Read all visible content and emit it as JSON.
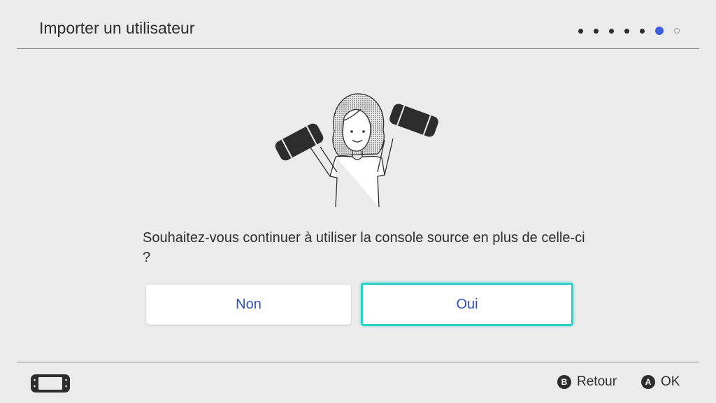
{
  "header": {
    "title": "Importer un utilisateur",
    "progress": {
      "total_steps": 7,
      "current_step": 6
    }
  },
  "illustration": {
    "name": "woman-holding-consoles"
  },
  "dialog": {
    "question": "Souhaitez-vous continuer à utiliser la console source en plus de celle-ci ?",
    "options": [
      {
        "label": "Non",
        "selected": false
      },
      {
        "label": "Oui",
        "selected": true
      }
    ]
  },
  "footer": {
    "console_icon": "handheld-console-icon",
    "back": {
      "button": "B",
      "label": "Retour"
    },
    "ok": {
      "button": "A",
      "label": "OK"
    }
  },
  "colors": {
    "background": "#ebebeb",
    "text": "#2d2d2d",
    "accent_blue": "#3c5fe0",
    "button_text": "#2f4fbf",
    "focus_outline": "#2ad1c9"
  }
}
